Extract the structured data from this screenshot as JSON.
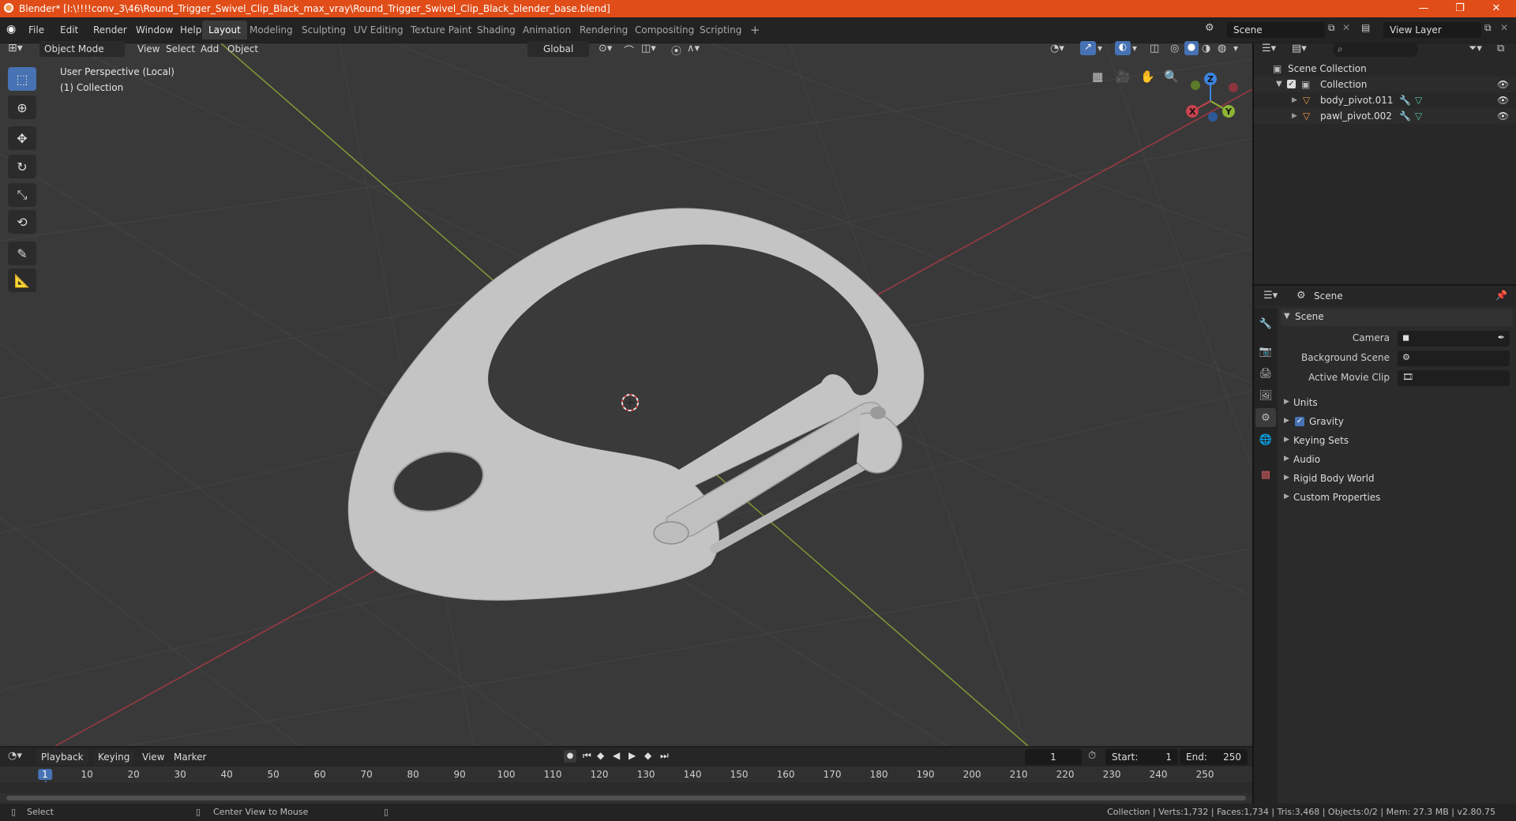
{
  "window": {
    "title": "Blender* [I:\\!!!!conv_3\\46\\Round_Trigger_Swivel_Clip_Black_max_vray\\Round_Trigger_Swivel_Clip_Black_blender_base.blend]",
    "minimize": "—",
    "maximize": "❐",
    "close": "✕"
  },
  "menu": [
    "File",
    "Edit",
    "Render",
    "Window",
    "Help"
  ],
  "workspaces": [
    "Layout",
    "Modeling",
    "Sculpting",
    "UV Editing",
    "Texture Paint",
    "Shading",
    "Animation",
    "Rendering",
    "Compositing",
    "Scripting"
  ],
  "workspace_add": "+",
  "scene_field": "Scene",
  "view_layer_field": "View Layer",
  "viewport": {
    "mode": "Object Mode",
    "menus": [
      "View",
      "Select",
      "Add",
      "Object"
    ],
    "transform": "Global",
    "overlay_text_1": "User Perspective (Local)",
    "overlay_text_2": "(1) Collection",
    "gizmo_x": "X",
    "gizmo_y": "Y",
    "gizmo_z": "Z"
  },
  "outliner": {
    "search_placeholder": "",
    "scene_collection": "Scene Collection",
    "collection": "Collection",
    "objects": [
      "body_pivot.011",
      "pawl_pivot.002"
    ]
  },
  "properties": {
    "header": "Scene",
    "panel_title": "Scene",
    "camera_label": "Camera",
    "background_scene_label": "Background Scene",
    "active_movie_clip_label": "Active Movie Clip",
    "subpanels": [
      "Units",
      "Gravity",
      "Keying Sets",
      "Audio",
      "Rigid Body World",
      "Custom Properties"
    ],
    "gravity_checked": true
  },
  "timeline": {
    "menus": [
      "Playback",
      "Keying",
      "View",
      "Marker"
    ],
    "current_frame": "1",
    "start_label": "Start:",
    "start_value": "1",
    "end_label": "End:",
    "end_value": "250",
    "frame_marks": [
      "1",
      "10",
      "20",
      "30",
      "40",
      "50",
      "60",
      "70",
      "80",
      "90",
      "100",
      "110",
      "120",
      "130",
      "140",
      "150",
      "160",
      "170",
      "180",
      "190",
      "200",
      "210",
      "220",
      "230",
      "240",
      "250"
    ],
    "frame_values": [
      1,
      10,
      20,
      30,
      40,
      50,
      60,
      70,
      80,
      90,
      100,
      110,
      120,
      130,
      140,
      150,
      160,
      170,
      180,
      190,
      200,
      210,
      220,
      230,
      240,
      250
    ]
  },
  "status": {
    "select": "Select",
    "center_view": "Center View to Mouse",
    "stats": "Collection | Verts:1,732 | Faces:1,734 | Tris:3,468 | Objects:0/2 | Mem: 27.3 MB | v2.80.75"
  },
  "colors": {
    "title_bar": "#e04d18",
    "accent": "#4772b3",
    "x_axis": "#c8434e",
    "y_axis": "#8db336",
    "z_axis": "#3d85e0",
    "object_orange": "#e8964a"
  }
}
